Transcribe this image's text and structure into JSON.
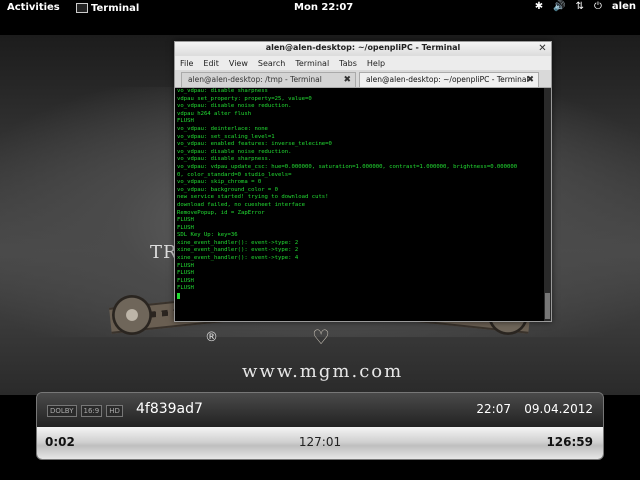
{
  "topbar": {
    "activities": "Activities",
    "app": "Terminal",
    "clock": "Mon 22:07",
    "user": "alen",
    "tray_icons": [
      "accessibility-icon",
      "volume-icon",
      "network-icon",
      "power-icon"
    ]
  },
  "video": {
    "logo_tr": "TR",
    "logo_registered": "®",
    "logo_url": "www.mgm.com"
  },
  "terminal": {
    "title": "alen@alen-desktop: ~/openpliPC - Terminal",
    "menu": [
      "File",
      "Edit",
      "View",
      "Search",
      "Terminal",
      "Tabs",
      "Help"
    ],
    "tabs": [
      {
        "label": "alen@alen-desktop: /tmp - Terminal",
        "active": false
      },
      {
        "label": "alen@alen-desktop: ~/openpliPC - Terminal",
        "active": true
      }
    ],
    "lines": [
      "vo_vdpau: disable sharpness",
      "vdpau set_property: property=25, value=0",
      "vo_vdpau: disable noise reduction.",
      "vdpau h264 alter flush",
      "FLUSH",
      "vo_vdpau: deinterlace: none",
      "vo_vdpau: set_scaling_level=1",
      "vo_vdpau: enabled features: inverse_telecine=0",
      "vo_vdpau: disable noise reduction.",
      "vo_vdpau: disable sharpness.",
      "vo_vdpau: vdpau_update_csc: hue=0.000000, saturation=1.000000, contrast=1.000000, brightness=0.000000",
      "0, color_standard=0 studio_levels=",
      "vo_vdpau: skip_chroma = 0",
      "vo_vdpau: background_color = 0",
      "new service started! trying to download cuts!",
      "download failed, no cuesheet interface",
      "RemovePopup, id = ZapError",
      "FLUSH",
      "FLUSH",
      "SDL Key Up: key=36",
      "xine_event_handler(): event->type: 2",
      "xine_event_handler(): event->type: 2",
      "xine_event_handler(): event->type: 4",
      "FLUSH",
      "FLUSH",
      "FLUSH",
      "FLUSH"
    ]
  },
  "osd": {
    "badges": [
      "DOLBY",
      "16:9",
      "HD"
    ],
    "title": "4f839ad7",
    "time": "22:07",
    "date": "09.04.2012",
    "elapsed": "0:02",
    "position": "127:01",
    "total": "126:59",
    "progress": 0.0
  }
}
